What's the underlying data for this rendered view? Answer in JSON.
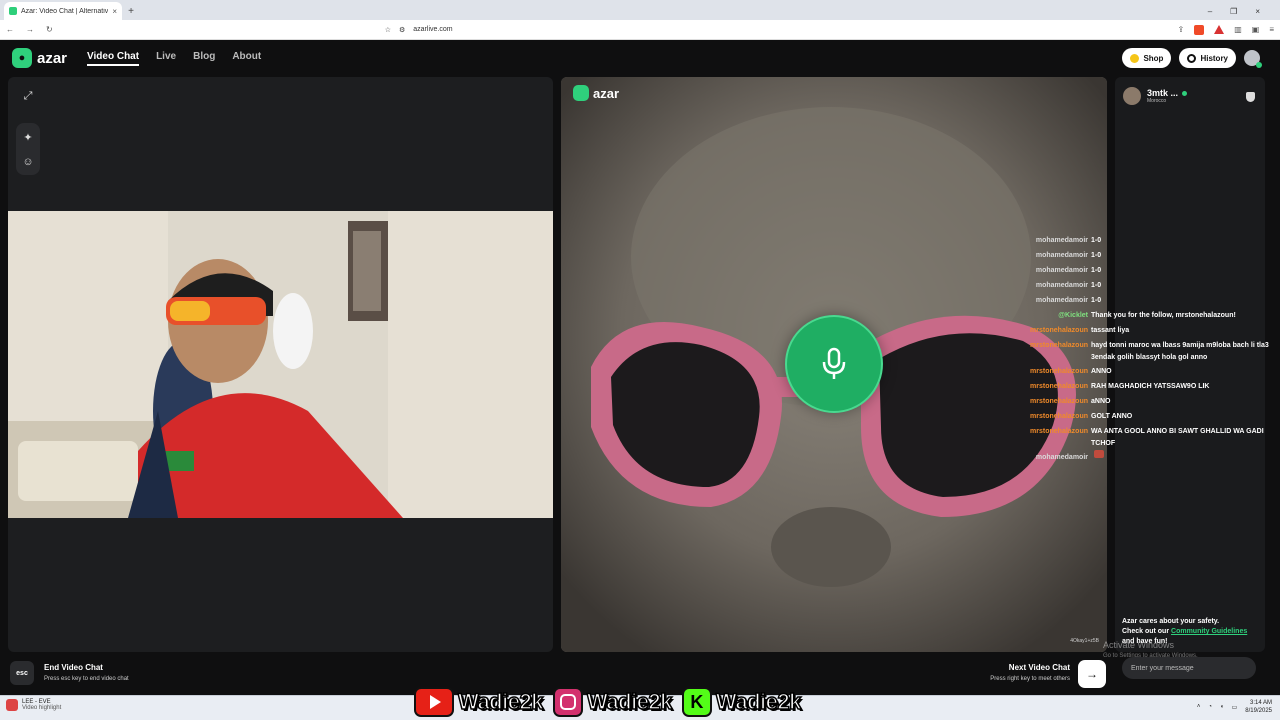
{
  "browser": {
    "tab_title": "Azar: Video Chat | Alternativ",
    "new_tab": "+",
    "close_tab": "×",
    "window_controls": [
      "–",
      "❐",
      "×"
    ],
    "url": "azarlive.com"
  },
  "app": {
    "brand": "azar",
    "nav": [
      "Video Chat",
      "Live",
      "Blog",
      "About"
    ],
    "shop_label": "Shop",
    "history_label": "History",
    "accent_color": "#2fd07c"
  },
  "partner": {
    "name": "3mtk ...",
    "country": "Morocco"
  },
  "chat": [
    {
      "user": "mohamedamoir",
      "text": "1-0",
      "color": "gray"
    },
    {
      "user": "mohamedamoir",
      "text": "1-0",
      "color": "gray"
    },
    {
      "user": "mohamedamoir",
      "text": "1-0",
      "color": "gray"
    },
    {
      "user": "mohamedamoir",
      "text": "1-0",
      "color": "gray"
    },
    {
      "user": "mohamedamoir",
      "text": "1-0",
      "color": "gray"
    },
    {
      "user": "@Kicklet",
      "text": "Thank you for the follow, mrstonehalazoun!",
      "color": "green"
    },
    {
      "user": "mrstonehalazoun",
      "text": "tassant liya",
      "color": "orange"
    },
    {
      "user": "mrstonehalazoun",
      "text": "hayd tonni maroc wa lbass 9amija m9loba bach li tla3 3endak golih blassyt hola gol anno",
      "color": "orange",
      "wrap": true
    },
    {
      "user": "mrstonehalazoun",
      "text": "ANNO",
      "color": "orange"
    },
    {
      "user": "mrstonehalazoun",
      "text": "RAH MAGHADICH YATSSAW9O LIK",
      "color": "orange"
    },
    {
      "user": "mrstonehalazoun",
      "text": "aNNO",
      "color": "orange"
    },
    {
      "user": "mrstonehalazoun",
      "text": "GOLT ANNO",
      "color": "orange"
    },
    {
      "user": "mrstonehalazoun",
      "text": "WA ANTA GOOL ANNO BI SAWT GHALLID WA GADI TCHOF",
      "color": "orange",
      "wrap": true
    },
    {
      "user": "mohamedamoir",
      "text": "",
      "color": "gray",
      "emote": true
    }
  ],
  "safety": {
    "line1": "Azar cares about your safety.",
    "line2_prefix": "Check out our ",
    "link": "Community Guidelines",
    "line2_suffix": " and have fun!"
  },
  "controls": {
    "esc_key": "esc",
    "end_title": "End Video Chat",
    "end_sub": "Press esc key to end video chat",
    "next_title": "Next Video Chat",
    "next_sub": "Press right key to meet others",
    "message_placeholder": "Enter your message"
  },
  "stream_code": "4Okay1+z5B",
  "windows": {
    "activate_title": "Activate Windows",
    "activate_sub": "Go to Settings to activate Windows."
  },
  "overlay_socials": [
    {
      "platform": "youtube-icon",
      "handle": "Wadie2k"
    },
    {
      "platform": "instagram-icon",
      "handle": "Wadie2k"
    },
    {
      "platform": "kick-icon",
      "handle": "Wadie2k"
    }
  ],
  "taskbar": {
    "media_title": "LEE - EVE",
    "media_sub": "Video highlight",
    "time": "3:14 AM",
    "date": "8/19/2025"
  }
}
